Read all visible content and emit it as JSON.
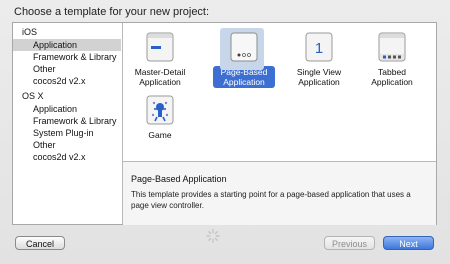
{
  "window": {
    "title": "Choose a template for your new project:"
  },
  "sidebar": {
    "sections": [
      {
        "heading": "iOS",
        "items": [
          "Application",
          "Framework & Library",
          "Other",
          "cocos2d v2.x"
        ]
      },
      {
        "heading": "OS X",
        "items": [
          "Application",
          "Framework & Library",
          "System Plug-in",
          "Other",
          "cocos2d v2.x"
        ]
      }
    ],
    "selected": "iOS > Application"
  },
  "templates": [
    {
      "label": "Master-Detail Application",
      "icon": "master-detail-icon"
    },
    {
      "label": "Page-Based Application",
      "icon": "page-based-icon",
      "selected": true
    },
    {
      "label": "Single View Application",
      "icon": "single-view-icon",
      "glyph": "1"
    },
    {
      "label": "Tabbed Application",
      "icon": "tabbed-icon"
    },
    {
      "label": "Game",
      "icon": "game-icon"
    }
  ],
  "description": {
    "title": "Page-Based Application",
    "body": "This template provides a starting point for a page-based application that uses a page view controller."
  },
  "buttons": {
    "cancel": "Cancel",
    "previous": "Previous",
    "next": "Next"
  },
  "colors": {
    "selection": "#3d6fd3",
    "sidebar_selection": "#d2d2d2",
    "primary_button": "#3d78dd"
  }
}
